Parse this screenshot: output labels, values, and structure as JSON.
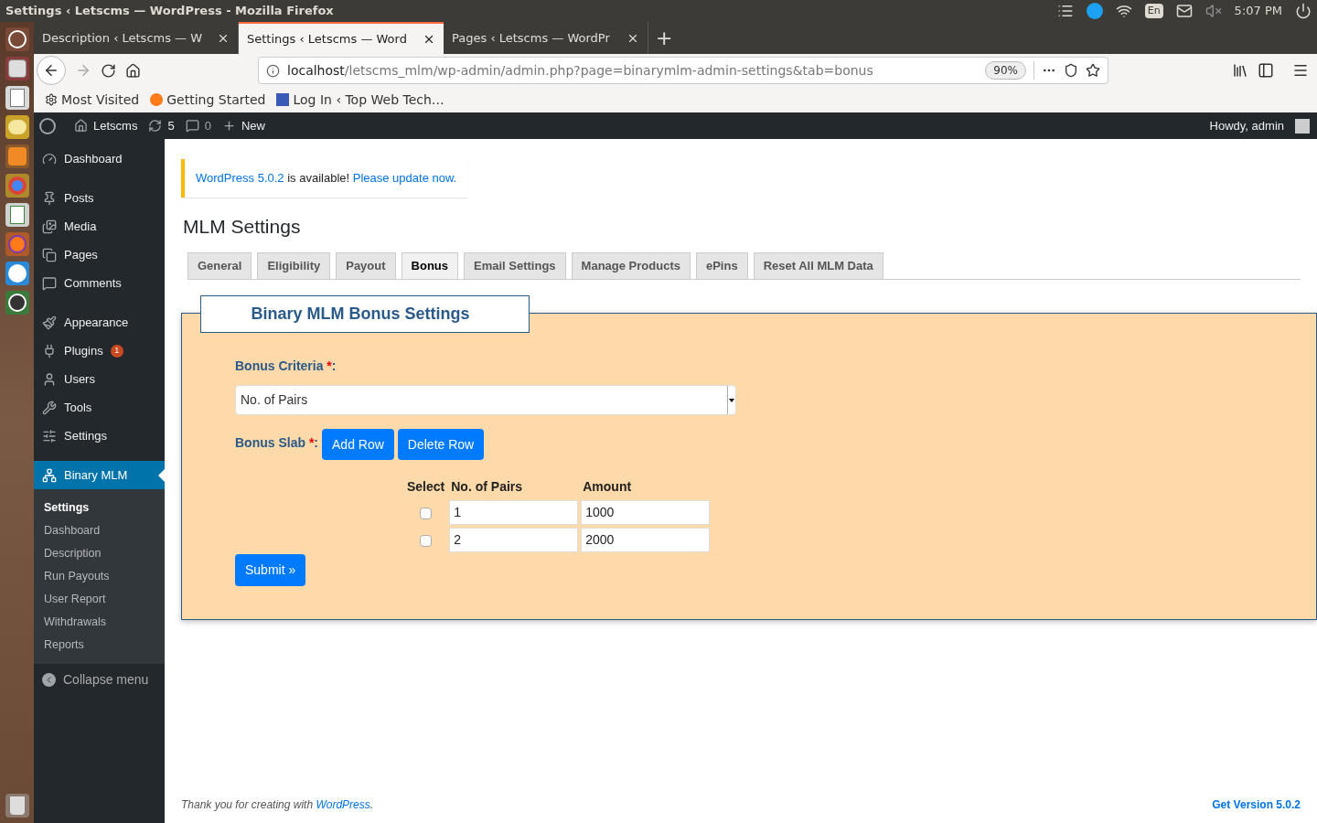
{
  "os_bar": {
    "title": "Settings ‹ Letscms — WordPress - Mozilla Firefox",
    "keyboard": "En",
    "time": "5:07 PM"
  },
  "browser": {
    "tabs": [
      {
        "label": "Description ‹ Letscms — W",
        "selected": false
      },
      {
        "label": "Settings ‹ Letscms — Word",
        "selected": true
      },
      {
        "label": "Pages ‹ Letscms — WordPr",
        "selected": false
      }
    ],
    "new_tab": "+",
    "url_host": "localhost",
    "url_path": "/letscms_mlm/wp-admin/admin.php?page=binarymlm-admin-settings&tab=bonus",
    "zoom": "90%",
    "bookmarks": [
      "Most Visited",
      "Getting Started",
      "Log In ‹ Top Web Tech…"
    ]
  },
  "admin_bar": {
    "site": "Letscms",
    "updates": "5",
    "comments": "0",
    "new": "New",
    "greeting": "Howdy, admin"
  },
  "sidebar": {
    "groups": [
      {
        "items": [
          {
            "label": "Dashboard",
            "selected": false
          }
        ]
      },
      {
        "items": [
          {
            "label": "Posts",
            "selected": false
          },
          {
            "label": "Media",
            "selected": false
          },
          {
            "label": "Pages",
            "selected": false
          },
          {
            "label": "Comments",
            "selected": false
          }
        ]
      },
      {
        "items": [
          {
            "label": "Appearance",
            "selected": false
          },
          {
            "label": "Plugins",
            "selected": false,
            "badge": "1"
          },
          {
            "label": "Users",
            "selected": false
          },
          {
            "label": "Tools",
            "selected": false
          },
          {
            "label": "Settings",
            "selected": false
          }
        ]
      },
      {
        "items": [
          {
            "label": "Binary MLM",
            "selected": true
          }
        ]
      }
    ],
    "submenu": [
      {
        "label": "Settings",
        "selected": true
      },
      {
        "label": "Dashboard",
        "selected": false
      },
      {
        "label": "Description",
        "selected": false
      },
      {
        "label": "Run Payouts",
        "selected": false
      },
      {
        "label": "User Report",
        "selected": false
      },
      {
        "label": "Withdrawals",
        "selected": false
      },
      {
        "label": "Reports",
        "selected": false
      }
    ],
    "collapse": "Collapse menu"
  },
  "notice": {
    "link": "WordPress 5.0.2",
    "text": " is available! ",
    "action": "Please update now."
  },
  "page_title": "MLM Settings",
  "tabs": [
    {
      "label": "General",
      "selected": false
    },
    {
      "label": "Eligibility",
      "selected": false
    },
    {
      "label": "Payout",
      "selected": false
    },
    {
      "label": "Bonus",
      "selected": true
    },
    {
      "label": "Email Settings",
      "selected": false
    },
    {
      "label": "Manage Products",
      "selected": false
    },
    {
      "label": "ePins",
      "selected": false
    },
    {
      "label": "Reset All MLM Data",
      "selected": false
    }
  ],
  "panel": {
    "legend": "Binary MLM Bonus Settings",
    "criteria": {
      "label": "Bonus Criteria ",
      "mark": "*",
      "suffix": ":",
      "value": "No. of Pairs"
    },
    "slab": {
      "label": "Bonus Slab ",
      "mark": "*",
      "suffix": ":",
      "buttons": [
        "Add Row",
        "Delete Row"
      ]
    },
    "table": {
      "columns": [
        "Select",
        "No. of Pairs",
        "Amount"
      ],
      "rows": [
        {
          "checked": false,
          "pairs": "1",
          "amount": "1000"
        },
        {
          "checked": false,
          "pairs": "2",
          "amount": "2000"
        }
      ]
    },
    "submit": "Submit »"
  },
  "footer": {
    "text": "Thank you for creating with ",
    "link": "WordPress",
    "end": ".",
    "version": "Get Version 5.0.2"
  }
}
